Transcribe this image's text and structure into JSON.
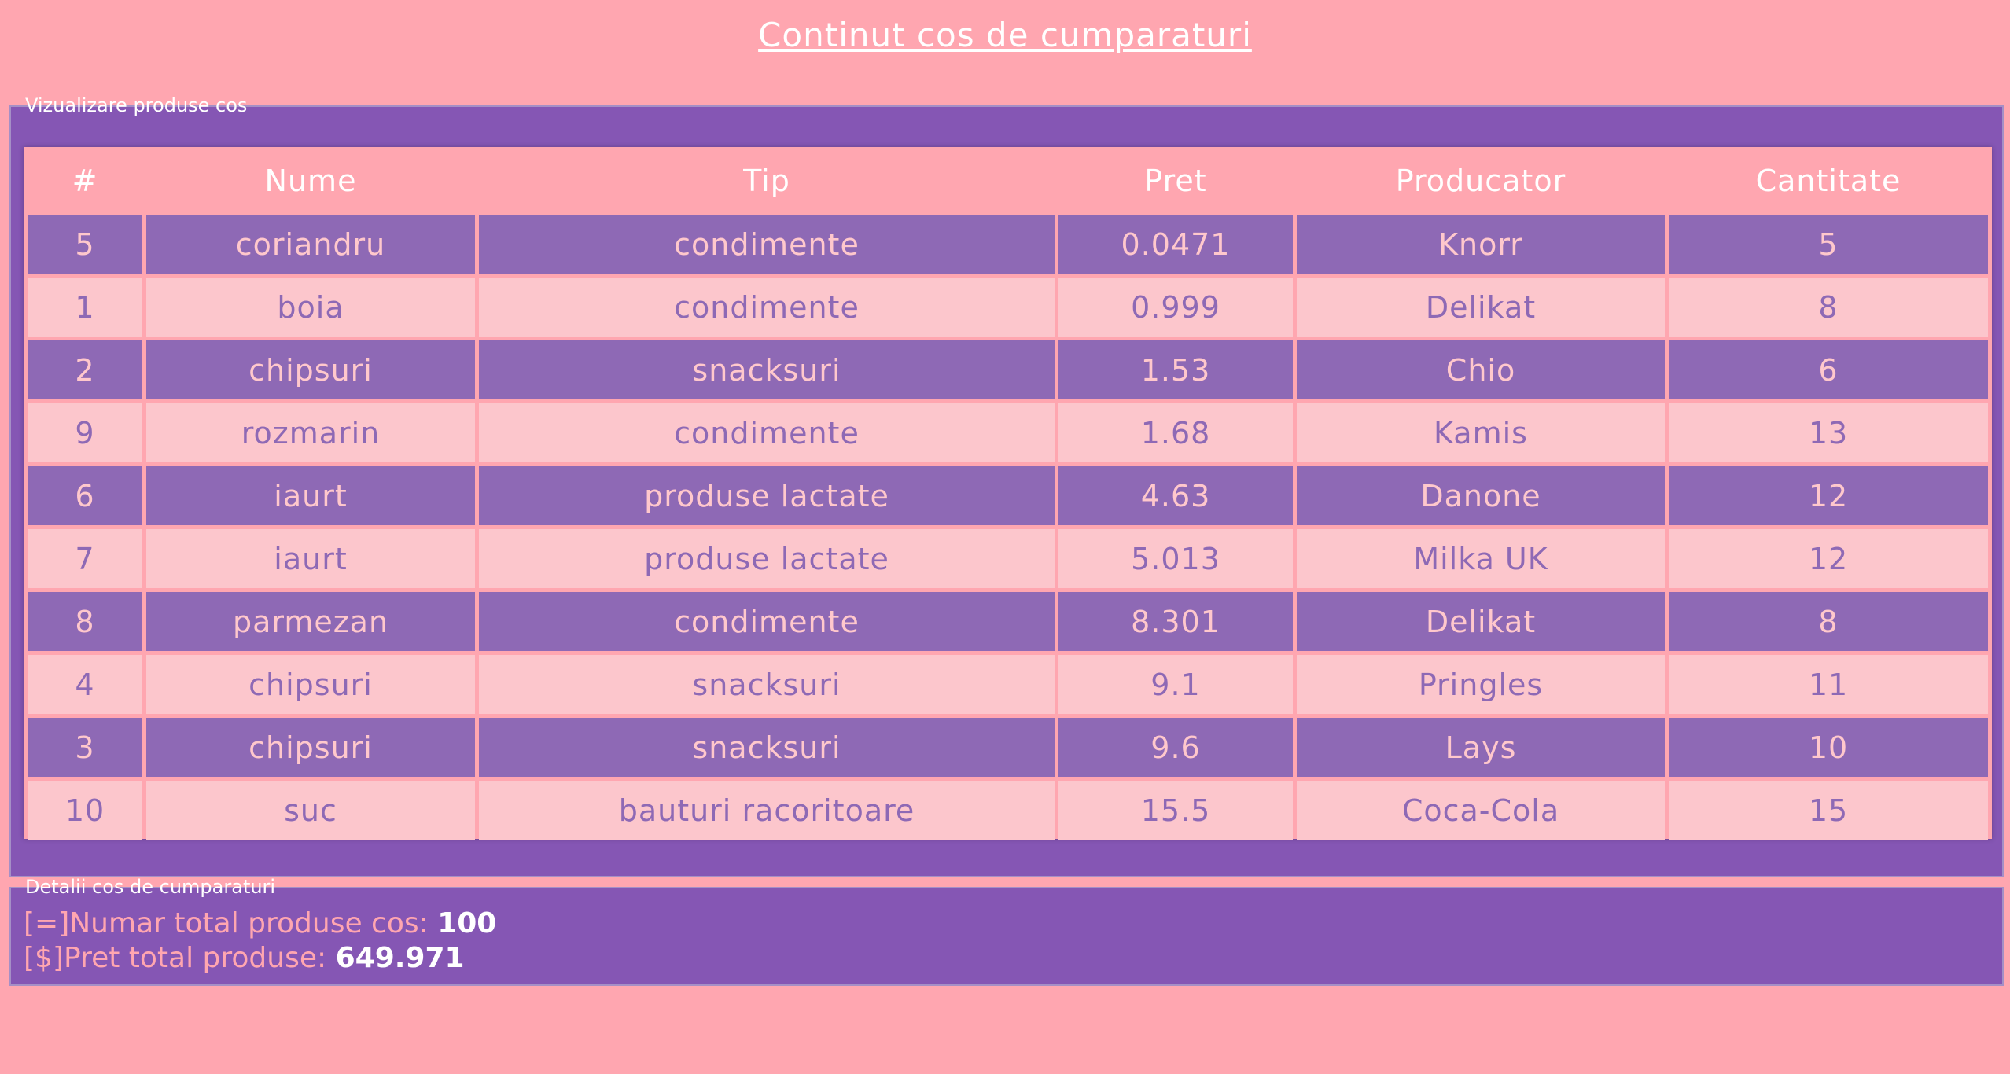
{
  "page_title": "Continut cos de cumparaturi",
  "products_section": {
    "legend": "Vizualizare produse cos",
    "columns": [
      "#",
      "Nume",
      "Tip",
      "Pret",
      "Producator",
      "Cantitate"
    ],
    "rows": [
      {
        "id": "5",
        "name": "coriandru",
        "type": "condimente",
        "price": "0.0471",
        "producer": "Knorr",
        "qty": "5"
      },
      {
        "id": "1",
        "name": "boia",
        "type": "condimente",
        "price": "0.999",
        "producer": "Delikat",
        "qty": "8"
      },
      {
        "id": "2",
        "name": "chipsuri",
        "type": "snacksuri",
        "price": "1.53",
        "producer": "Chio",
        "qty": "6"
      },
      {
        "id": "9",
        "name": "rozmarin",
        "type": "condimente",
        "price": "1.68",
        "producer": "Kamis",
        "qty": "13"
      },
      {
        "id": "6",
        "name": "iaurt",
        "type": "produse lactate",
        "price": "4.63",
        "producer": "Danone",
        "qty": "12"
      },
      {
        "id": "7",
        "name": "iaurt",
        "type": "produse lactate",
        "price": "5.013",
        "producer": "Milka UK",
        "qty": "12"
      },
      {
        "id": "8",
        "name": "parmezan",
        "type": "condimente",
        "price": "8.301",
        "producer": "Delikat",
        "qty": "8"
      },
      {
        "id": "4",
        "name": "chipsuri",
        "type": "snacksuri",
        "price": "9.1",
        "producer": "Pringles",
        "qty": "11"
      },
      {
        "id": "3",
        "name": "chipsuri",
        "type": "snacksuri",
        "price": "9.6",
        "producer": "Lays",
        "qty": "10"
      },
      {
        "id": "10",
        "name": "suc",
        "type": "bauturi racoritoare",
        "price": "15.5",
        "producer": "Coca-Cola",
        "qty": "15"
      }
    ]
  },
  "details_section": {
    "legend": "Detalii cos de cumparaturi",
    "total_products_label": "[=]Numar total produse cos: ",
    "total_products_value": "100",
    "total_price_label": "[$]Pret total produse: ",
    "total_price_value": "649.971"
  },
  "colors": {
    "background": "#ffa6b0",
    "panel": "#8556b4",
    "row_dark": "#8e69b5",
    "row_light": "#fcc6cc"
  }
}
